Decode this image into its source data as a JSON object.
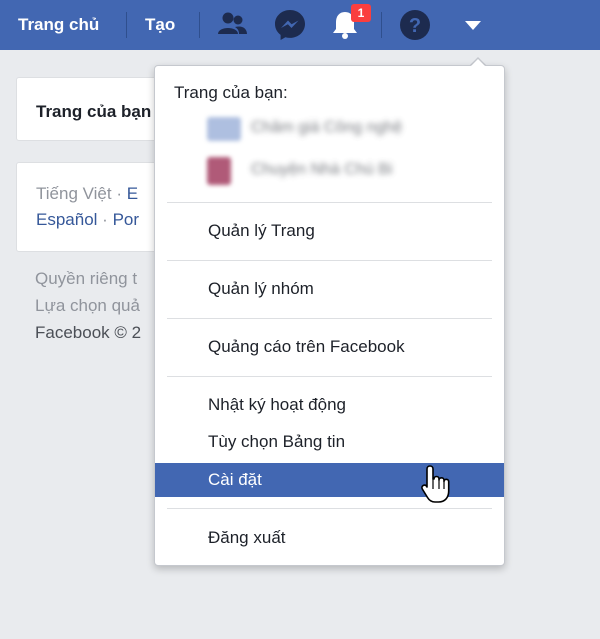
{
  "topbar": {
    "home_label": "Trang chủ",
    "create_label": "Tạo",
    "icons": {
      "friends": "friends-icon",
      "messenger": "messenger-icon",
      "notifications": "bell-icon",
      "help": "help-icon",
      "account_menu": "caret-down-icon"
    },
    "notification_count": "1"
  },
  "sidebar": {
    "pages_card_title": "Trang của bạn",
    "languages": {
      "current": "Tiếng Việt",
      "link_2": "E",
      "link_3": "Español",
      "link_4": "Por",
      "dot": "·"
    },
    "footer": {
      "line1": "Quyền riêng t",
      "line2": "Lựa chọn quả",
      "line3": "Facebook © 2"
    }
  },
  "menu": {
    "header": "Trang của bạn:",
    "pages": [
      {
        "name": "Chăm giá Công nghệ"
      },
      {
        "name": "Chuyện Nhà Chú Bi"
      }
    ],
    "items": {
      "manage_pages": "Quản lý Trang",
      "manage_groups": "Quản lý nhóm",
      "advertise": "Quảng cáo trên Facebook",
      "activity_log": "Nhật ký hoạt động",
      "news_feed_prefs": "Tùy chọn Bảng tin",
      "settings": "Cài đặt",
      "log_out": "Đăng xuất"
    }
  },
  "colors": {
    "topbar": "#4267b2",
    "background": "#e9ebee",
    "highlight": "#4267b2",
    "badge": "#fa3e3e",
    "link": "#365899"
  }
}
